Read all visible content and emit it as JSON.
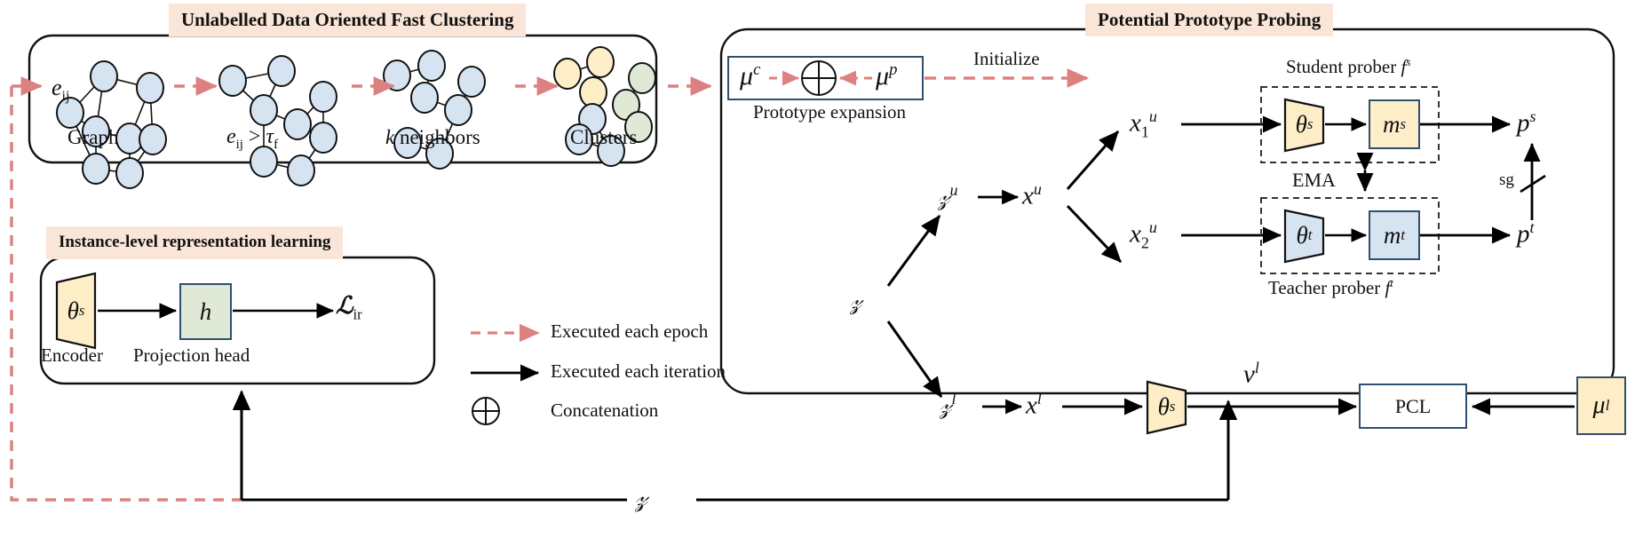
{
  "figure": {
    "type": "diagram",
    "description": "Framework diagram with three modules: Unlabelled Data Oriented Fast Clustering, Instance-level representation learning, and Potential Prototype Probing"
  },
  "panels": {
    "clustering": {
      "title": "Unlabelled Data Oriented Fast Clustering",
      "edge_label": "e_ij",
      "stages": [
        {
          "label": "Graph"
        },
        {
          "label": "e_ij > tau_f"
        },
        {
          "label": "k neighbors"
        },
        {
          "label": "Clusters"
        }
      ],
      "stage_labels_plain": [
        "Graph",
        "",
        "neighbors",
        "Clusters"
      ],
      "stage2_expr": {
        "base": "e",
        "sub": "ij",
        "op": ">",
        "tau": "τ",
        "tau_sub": "f"
      },
      "stage3_expr": {
        "k": "k",
        "word": "neighbors"
      },
      "node_colors": {
        "blue": "#d6e4f2",
        "yellow": "#fdeec8",
        "green": "#dfe9d5",
        "stroke": "#111111"
      }
    },
    "instance": {
      "title": "Instance-level representation learning",
      "encoder_symbol": "θ",
      "encoder_sup": "s",
      "encoder_caption": "Encoder",
      "head_symbol": "h",
      "head_caption": "Projection head",
      "loss_symbol": "ℒ",
      "loss_sub": "ir"
    },
    "probing": {
      "title": "Potential Prototype Probing",
      "prototype_box": {
        "left_symbol": "μ",
        "left_sup": "c",
        "op": "⊕",
        "right_symbol": "μ",
        "right_sup": "p",
        "caption": "Prototype expansion"
      },
      "initialize_label": "Initialize",
      "dataset": {
        "symbol": "𝒟"
      },
      "unlabelled": {
        "symbol": "𝒟",
        "sup": "u"
      },
      "labelled": {
        "symbol": "𝒟",
        "sup": "l"
      },
      "x_u": {
        "symbol": "x",
        "sup": "u"
      },
      "x_u1": {
        "symbol": "x",
        "sup": "u",
        "sub": "1"
      },
      "x_u2": {
        "symbol": "x",
        "sup": "u",
        "sub": "2"
      },
      "x_l": {
        "symbol": "x",
        "sup": "l"
      },
      "student": {
        "caption": "Student prober",
        "caption_symbol": "f",
        "caption_sup": "s",
        "encoder": "θ",
        "encoder_sup": "s",
        "head": "m",
        "head_sup": "s",
        "output": "p",
        "output_sup": "s",
        "color": "#fdeec8",
        "border": "#2f4f6f"
      },
      "teacher": {
        "caption": "Teacher prober",
        "caption_symbol": "f",
        "caption_sup": "t",
        "encoder": "θ",
        "encoder_sup": "t",
        "head": "m",
        "head_sup": "t",
        "output": "p",
        "output_sup": "t",
        "color": "#d6e4f2",
        "border": "#2f4f6f"
      },
      "ema_label": "EMA",
      "sg_label": "sg",
      "pcl_label": "PCL",
      "v_l": {
        "symbol": "v",
        "sup": "l"
      },
      "mu_l": {
        "symbol": "μ",
        "sup": "l"
      }
    }
  },
  "legend": {
    "items": [
      {
        "kind": "dashed-arrow",
        "label": "Executed each epoch",
        "color": "#dd8080"
      },
      {
        "kind": "solid-arrow",
        "label": "Executed each iteration",
        "color": "#000000"
      },
      {
        "kind": "circle-plus",
        "label": "Concatenation",
        "color": "#000000"
      }
    ]
  },
  "bottom_flow": {
    "dataset_symbol": "𝒟"
  },
  "colors": {
    "title_bg": "#fae6d9",
    "dashed_red": "#dd8080",
    "node_blue": "#d6e4f2",
    "node_yellow": "#fdeec8",
    "node_green": "#dfe9d5",
    "box_border": "#2f4f6f",
    "line_black": "#000000"
  }
}
